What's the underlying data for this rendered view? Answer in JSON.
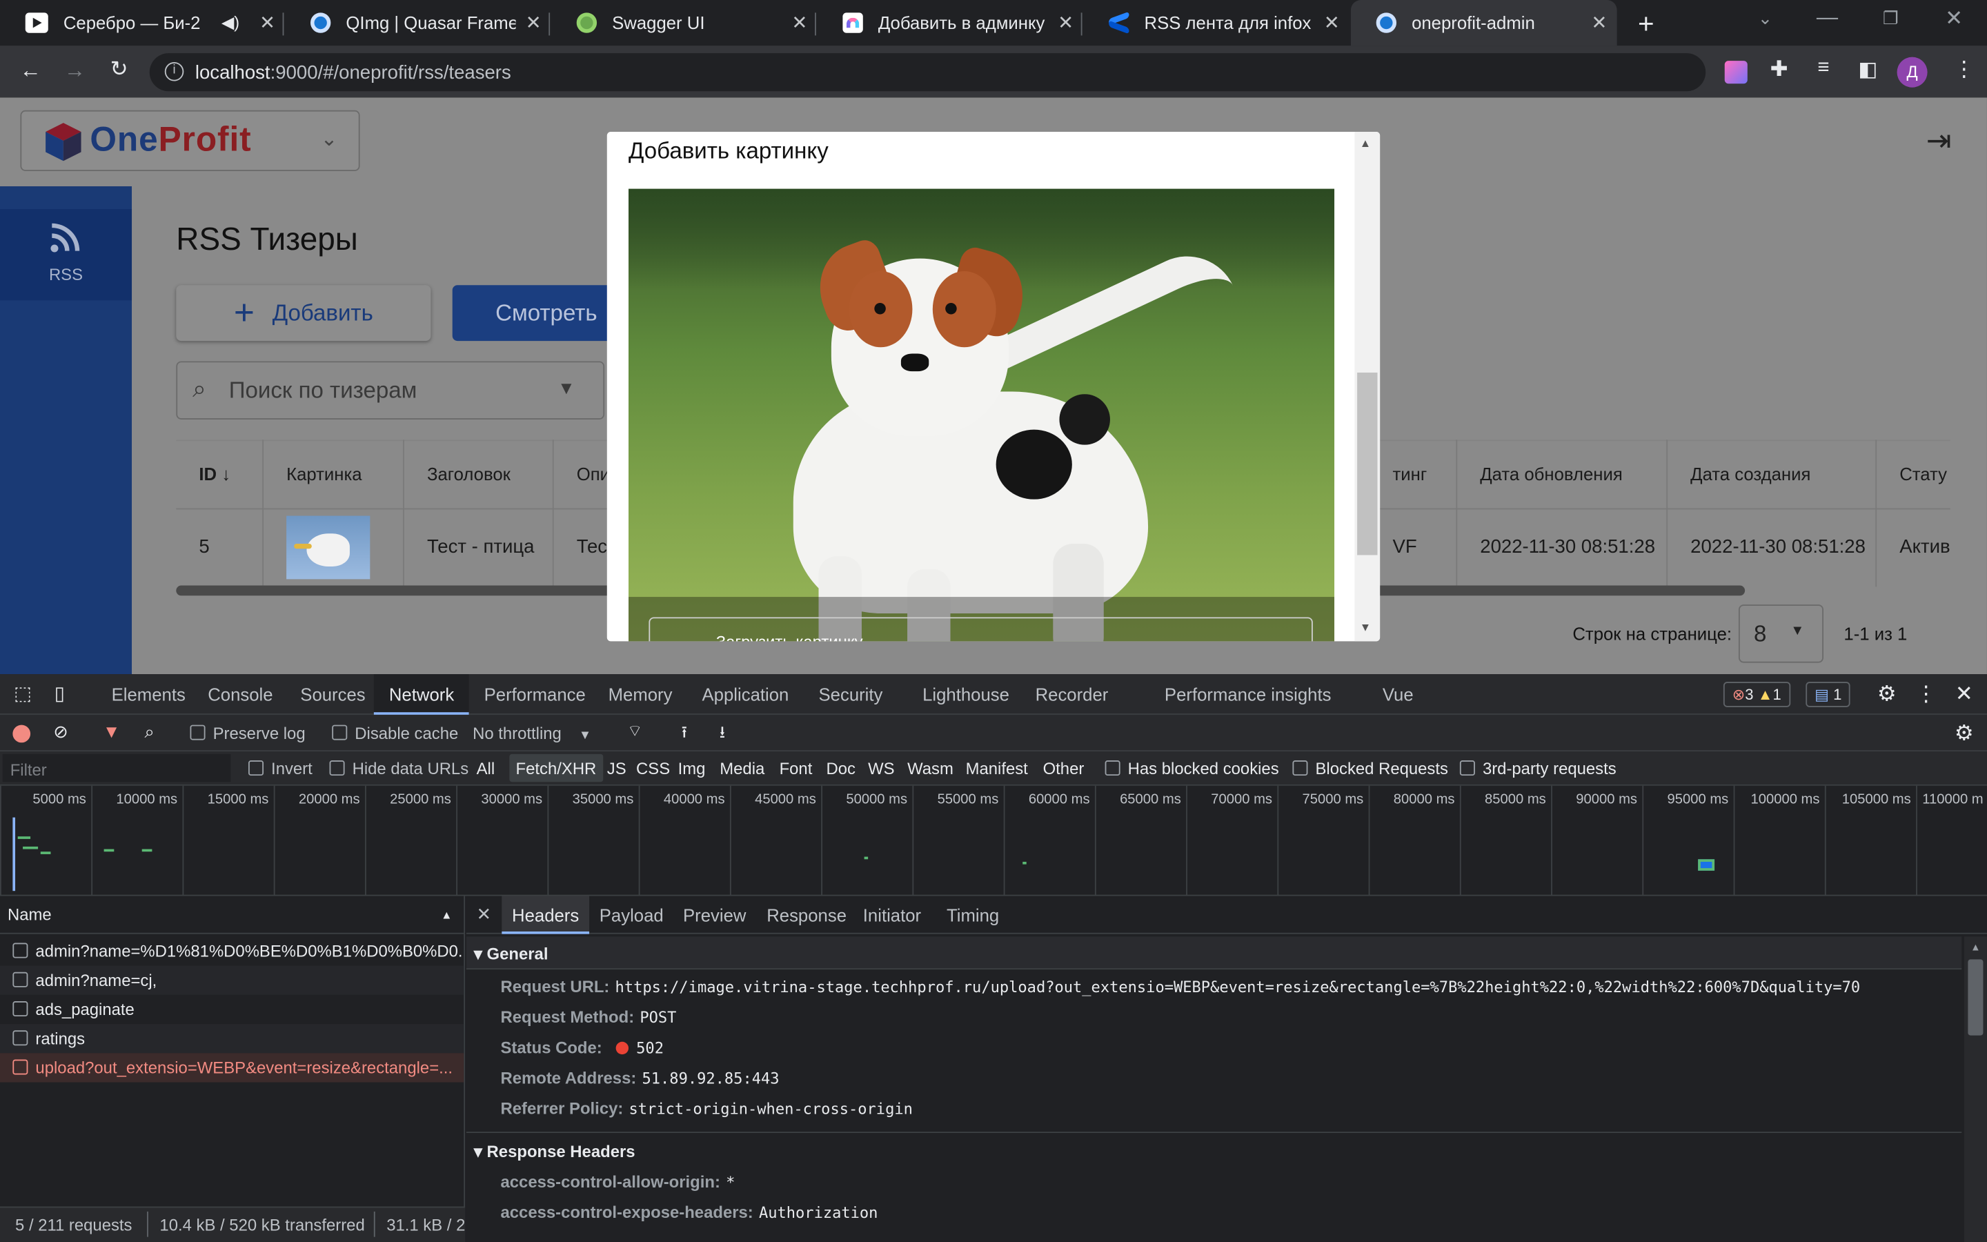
{
  "browser": {
    "tabs": [
      {
        "title": "Серебро — Би-2",
        "fav_color": "#ffffff",
        "has_mute": true
      },
      {
        "title": "QImg | Quasar Framework",
        "fav_color": "#1976d2"
      },
      {
        "title": "Swagger UI",
        "fav_color": "#6aa84f"
      },
      {
        "title": "Добавить в админку (on",
        "fav_color": "#ffffff"
      },
      {
        "title": "RSS лента для infox rela",
        "fav_color": "#2684ff"
      },
      {
        "title": "oneprofit-admin",
        "fav_color": "#1976d2",
        "active": true
      }
    ],
    "url_host": "localhost",
    "url_rest": ":9000/#/oneprofit/rss/teasers",
    "profile_initial": "Д"
  },
  "app": {
    "brand_one": "One",
    "brand_profit": "Profit",
    "sidebar_rss": "RSS",
    "page_title": "RSS Тизеры",
    "add_button": "Добавить",
    "view_button": "Смотреть",
    "search_placeholder": "Поиск по тизерам",
    "columns": [
      "ID",
      "Картинка",
      "Заголовок",
      "Опи",
      "тинг",
      "Дата обновления",
      "Дата создания",
      "Стату"
    ],
    "row": {
      "id": "5",
      "title": "Тест - птица",
      "desc": "Тест",
      "rating": "VF",
      "updated": "2022-11-30 08:51:28",
      "created": "2022-11-30 08:51:28",
      "status": "Актив"
    },
    "rows_per_page_label": "Строк на странице:",
    "rows_per_page": "8",
    "range": "1-1 из 1"
  },
  "modal": {
    "title": "Добавить картинку",
    "upload_label": "Загрузить картинку"
  },
  "devtools": {
    "tabs": [
      "Elements",
      "Console",
      "Sources",
      "Network",
      "Performance",
      "Memory",
      "Application",
      "Security",
      "Lighthouse",
      "Recorder",
      "Performance insights",
      "Vue"
    ],
    "errors": "3",
    "warnings": "1",
    "messages": "1",
    "preserve_log": "Preserve log",
    "disable_cache": "Disable cache",
    "throttling": "No throttling",
    "filter_placeholder": "Filter",
    "invert": "Invert",
    "hide_data_urls": "Hide data URLs",
    "types": [
      "All",
      "Fetch/XHR",
      "JS",
      "CSS",
      "Img",
      "Media",
      "Font",
      "Doc",
      "WS",
      "Wasm",
      "Manifest",
      "Other"
    ],
    "has_blocked_cookies": "Has blocked cookies",
    "blocked_requests": "Blocked Requests",
    "third_party": "3rd-party requests",
    "ticks": [
      "5000 ms",
      "10000 ms",
      "15000 ms",
      "20000 ms",
      "25000 ms",
      "30000 ms",
      "35000 ms",
      "40000 ms",
      "45000 ms",
      "50000 ms",
      "55000 ms",
      "60000 ms",
      "65000 ms",
      "70000 ms",
      "75000 ms",
      "80000 ms",
      "85000 ms",
      "90000 ms",
      "95000 ms",
      "100000 ms",
      "105000 ms",
      "110000 m"
    ],
    "name_header": "Name",
    "requests": [
      {
        "name": "admin?name=%D1%81%D0%BE%D0%B1%D0%B0%D0...",
        "error": false
      },
      {
        "name": "admin?name=cj,",
        "error": false
      },
      {
        "name": "ads_paginate",
        "error": false
      },
      {
        "name": "ratings",
        "error": false
      },
      {
        "name": "upload?out_extensio=WEBP&event=resize&rectangle=...",
        "error": true
      }
    ],
    "detail_tabs": [
      "Headers",
      "Payload",
      "Preview",
      "Response",
      "Initiator",
      "Timing"
    ],
    "general_label": "General",
    "general": [
      {
        "k": "Request URL:",
        "v": "https://image.vitrina-stage.techhprof.ru/upload?out_extensio=WEBP&event=resize&rectangle=%7B%22height%22:0,%22width%22:600%7D&quality=70"
      },
      {
        "k": "Request Method:",
        "v": "POST"
      },
      {
        "k": "Status Code:",
        "v": "502"
      },
      {
        "k": "Remote Address:",
        "v": "51.89.92.85:443"
      },
      {
        "k": "Referrer Policy:",
        "v": "strict-origin-when-cross-origin"
      }
    ],
    "response_headers_label": "Response Headers",
    "response_headers": [
      {
        "k": "access-control-allow-origin:",
        "v": "*"
      },
      {
        "k": "access-control-expose-headers:",
        "v": "Authorization"
      }
    ],
    "status_requests": "5 / 211 requests",
    "status_transferred": "10.4 kB / 520 kB transferred",
    "status_resources": "31.1 kB / 2"
  }
}
